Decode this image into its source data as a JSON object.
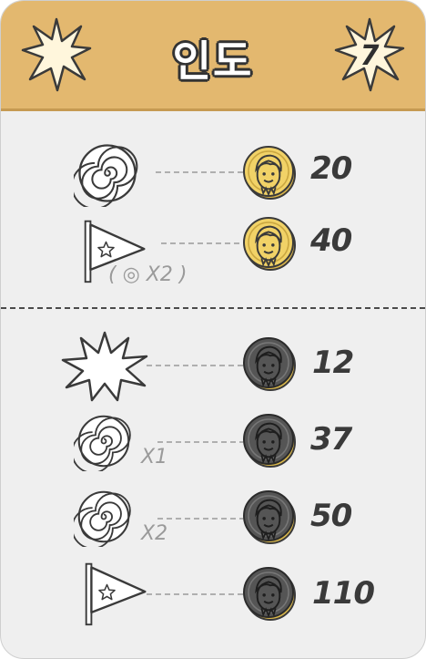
{
  "card": {
    "title": "인도",
    "round_number": "7",
    "colors": {
      "header": "#e3b86f",
      "gold_coin": "#f1d267",
      "dark_coin": "#555555",
      "body": "#efefef"
    }
  },
  "top_section": {
    "rows": [
      {
        "icon": "spiral-icon",
        "coin": "gold",
        "points": "20",
        "modifier": ""
      },
      {
        "icon": "flag-icon",
        "coin": "gold",
        "points": "40",
        "modifier": "( ◎ X2 )"
      }
    ]
  },
  "bottom_section": {
    "rows": [
      {
        "icon": "starburst-icon",
        "coin": "dark",
        "points": "12",
        "modifier": ""
      },
      {
        "icon": "spiral-icon",
        "coin": "dark",
        "points": "37",
        "modifier": "X1"
      },
      {
        "icon": "spiral-icon",
        "coin": "dark",
        "points": "50",
        "modifier": "X2"
      },
      {
        "icon": "flag-icon",
        "coin": "dark",
        "points": "110",
        "modifier": ""
      }
    ]
  }
}
